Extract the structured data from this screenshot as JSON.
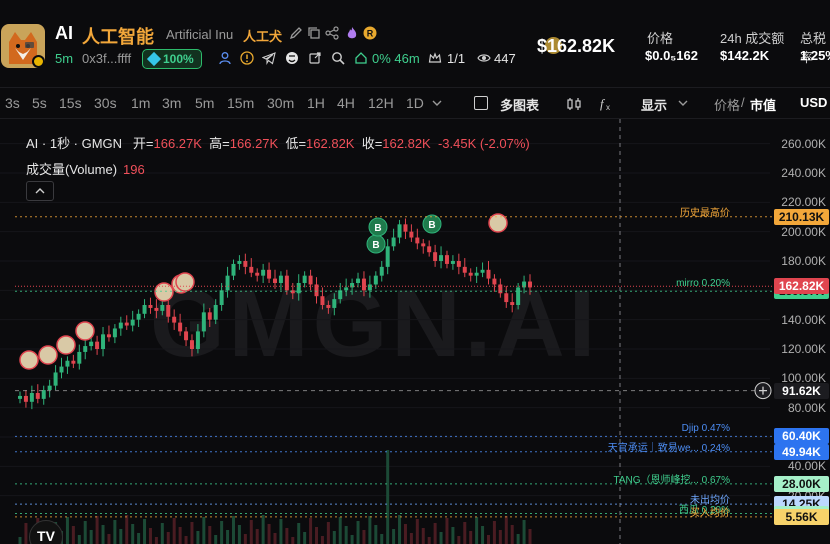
{
  "token": {
    "symbol": "AI",
    "name_cn": "人工智能",
    "name_en": "Artificial Inu",
    "name_cn_short": "人工犬",
    "age": "5m",
    "address": "0x3f...ffff",
    "score": "100%",
    "change_short": "0% 46m",
    "holders": "1/1",
    "views": "447",
    "market_cap": "$162.82K"
  },
  "stats": {
    "price_label": "价格",
    "price_value": "$0.0₅162",
    "vol_label": "24h 成交额",
    "vol_value": "$142.2K",
    "tax_label": "总税率",
    "tax_value": "1.25%"
  },
  "toolbar": {
    "timeframes": [
      "3s",
      "5s",
      "15s",
      "30s",
      "1m",
      "3m",
      "5m",
      "15m",
      "30m",
      "1H",
      "4H",
      "12H",
      "1D"
    ],
    "multi_chart": "多图表",
    "display": "显示",
    "price_label": "价格",
    "mcap_label": "市值",
    "currency": "USD"
  },
  "chart_info": {
    "symbol_line": "AI · 1秒 · GMGN",
    "open_label": "开=",
    "open_value": "166.27K",
    "high_label": "高=",
    "high_value": "166.27K",
    "low_label": "低=",
    "low_value": "162.82K",
    "close_label": "收=",
    "close_value": "162.82K",
    "change": "-3.45K (-2.07%)",
    "volume_label": "成交量(Volume)",
    "volume_value": "196",
    "watermark": "GMGN.AI"
  },
  "chart_data": {
    "type": "candlestick",
    "yaxis_ticks": [
      "260.00K",
      "240.00K",
      "220.00K",
      "200.00K",
      "180.00K",
      "160.00K",
      "140.00K",
      "120.00K",
      "100.00K",
      "80.00K",
      "60.00K",
      "40.00K",
      "20.00K"
    ],
    "ylim": [
      0,
      270000
    ],
    "close_series": [
      88,
      84,
      90,
      86,
      92,
      95,
      104,
      108,
      112,
      110,
      118,
      122,
      125,
      120,
      130,
      128,
      134,
      138,
      136,
      140,
      144,
      150,
      148,
      146,
      150,
      142,
      138,
      132,
      126,
      120,
      132,
      145,
      140,
      150,
      160,
      170,
      178,
      180,
      176,
      172,
      170,
      174,
      168,
      165,
      170,
      160,
      158,
      165,
      170,
      164,
      156,
      150,
      148,
      154,
      160,
      162,
      165,
      168,
      160,
      164,
      170,
      176,
      190,
      196,
      205,
      200,
      196,
      192,
      190,
      186,
      180,
      184,
      178,
      180,
      176,
      172,
      170,
      172,
      174,
      168,
      164,
      158,
      152,
      150,
      162,
      166,
      162
    ],
    "price_lines": [
      {
        "label": "历史最高价",
        "value": "210.13K"
      },
      {
        "label": "mirro 0.20%",
        "value": "159.37K"
      },
      {
        "label": "",
        "value": "91.62K"
      },
      {
        "label": "Djip 0.47%",
        "value": "60.40K"
      },
      {
        "label": "天官承运｜致易we... 0.24%",
        "value": "49.94K"
      },
      {
        "label": "TANG（恩师峰挖... 0.67%",
        "value": "28.00K"
      },
      {
        "label": "未出均价",
        "value": "14.25K"
      },
      {
        "label": "西瓜 0.20%",
        "value": "7.80K"
      },
      {
        "label": "买入均价",
        "value": "5.56K"
      }
    ],
    "current_value": "162.82K"
  },
  "colors": {
    "up": "#2fb37a",
    "down": "#e0454f",
    "accent": "#f2a73a",
    "bg": "#0b0b0d"
  }
}
